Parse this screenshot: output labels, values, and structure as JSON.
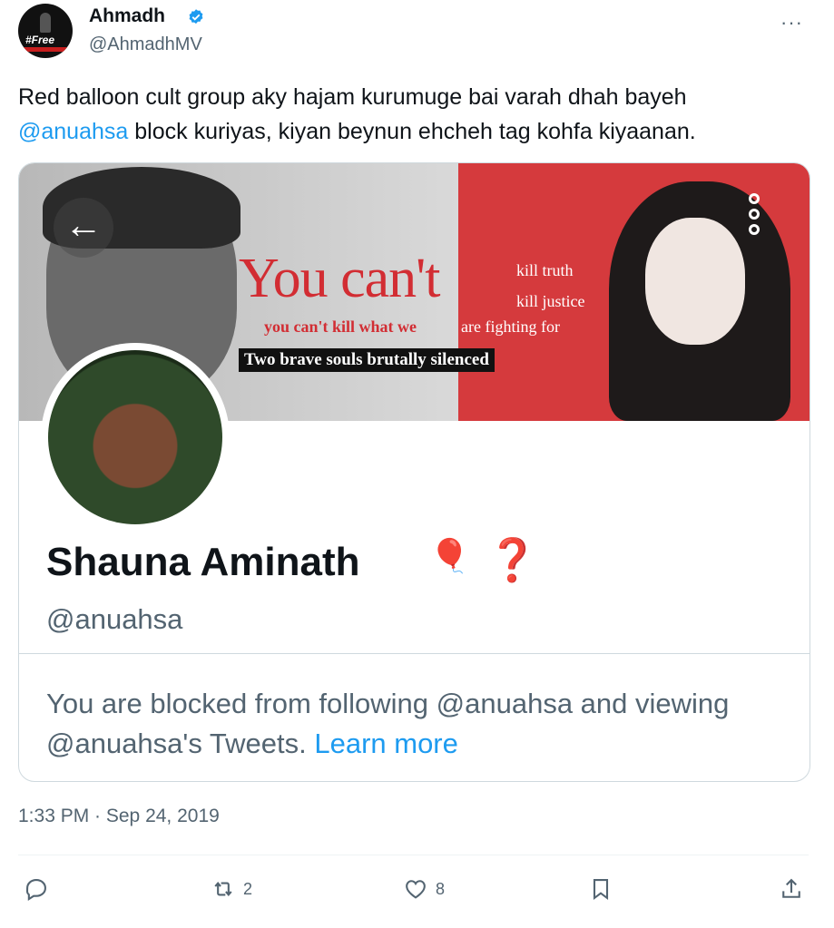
{
  "tweet": {
    "author_name": "Ahmadh",
    "author_handle": "@AhmadhMV",
    "avatar_text": "#Free",
    "more_label": "···",
    "text_before": "Red balloon cult group aky hajam kurumuge bai varah dhah bayeh",
    "mention": "@anuahsa",
    "text_after": "block kuriyas, kiyan beynun ehcheh tag kohfa kiyaanan.",
    "timestamp": "1:33 PM · Sep 24, 2019"
  },
  "card": {
    "banner": {
      "headline": "You can't",
      "line1": "kill truth",
      "line2": "kill justice",
      "line3a": "you can't kill what we",
      "line3b": "are fighting for",
      "black_strip": "Two brave souls brutally silenced"
    },
    "profile_name": "Shauna Aminath",
    "profile_emoji_balloon": "🎈",
    "profile_emoji_question": "❓",
    "profile_handle": "@anuahsa",
    "blocked_text": "You are blocked from following @anuahsa and viewing @anuahsa's Tweets.",
    "learn_more": "Learn more"
  },
  "actions": {
    "reply_count": "",
    "retweet_count": "2",
    "like_count": "8"
  },
  "colors": {
    "accent": "#1d9bf0",
    "muted": "#536471",
    "banner_red": "#d53a3d"
  }
}
